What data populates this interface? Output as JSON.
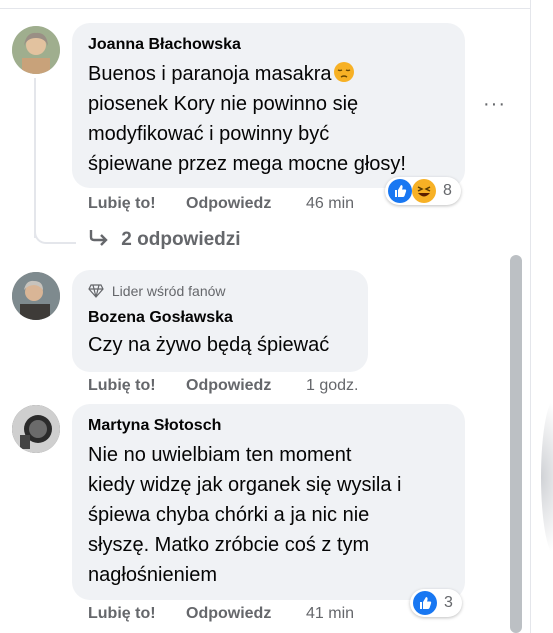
{
  "comments": [
    {
      "author": "Joanna Błachowska",
      "lines": [
        "Buenos i paranoja masakra",
        "piosenek Kory nie powinno się",
        "modyfikować i powinny być",
        "śpiewane przez mega mocne głosy!"
      ],
      "like_label": "Lubię to!",
      "reply_label": "Odpowiedz",
      "time": "46 min",
      "reaction_count": "8",
      "reaction_icons": [
        "like-icon",
        "haha-icon"
      ],
      "inline_emoji": "pensive-face-icon"
    },
    {
      "badge": "Lider wśród fanów",
      "author": "Bozena Gosławska",
      "lines": [
        "Czy na żywo będą śpiewać"
      ],
      "like_label": "Lubię to!",
      "reply_label": "Odpowiedz",
      "time": "1 godz."
    },
    {
      "author": "Martyna Słotosch",
      "lines": [
        "Nie no uwielbiam ten moment",
        "kiedy widzę jak organek się wysila i",
        "śpiewa chyba chórki a ja nic nie",
        "słyszę. Matko zróbcie coś z tym",
        "nagłośnieniem"
      ],
      "like_label": "Lubię to!",
      "reply_label": "Odpowiedz",
      "time": "41 min",
      "reaction_count": "3",
      "reaction_icons": [
        "like-icon"
      ]
    }
  ],
  "replies_link": "2 odpowiedzi",
  "more_options": "···",
  "colors": {
    "bubble": "#f0f2f5",
    "secondary_text": "#65676b",
    "like_blue": "#1877f2",
    "haha_yellow": "#f7b125"
  }
}
